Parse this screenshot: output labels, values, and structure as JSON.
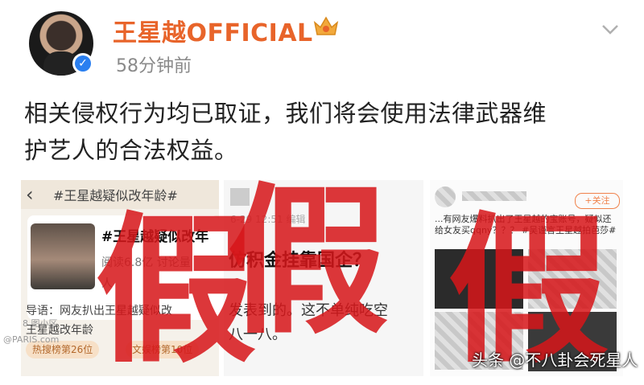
{
  "post": {
    "username": "王星越OFFICIAL",
    "time": "58分钟前",
    "text_line1": "相关侵权行为均已取证，我们将会使用法律武器维",
    "text_line2": "护艺人的合法权益。"
  },
  "image1": {
    "tag": "#王星越疑似改年龄#",
    "card_title": "#王星越疑似改年",
    "stat_line": "阅读6.8亿 讨论量",
    "stat_line2": "人",
    "guide": "导语：网友扒出王星越疑似改",
    "guide2": "王星越改年龄",
    "pill1": "热搜榜第26位",
    "pill2": "文娱榜第10位",
    "watermark": "8 图小区",
    "site_watermark": "@PARIS.com"
  },
  "image2": {
    "meta": "6-29 12:51 编辑",
    "headline": "仿积金挂靠国企？",
    "body1": "发表到的。这不单纯吃空",
    "body2": "八一八。"
  },
  "image3": {
    "follow": "+关注",
    "text": "...有网友爆料扒出了王星越的宝账号，疑似还给女友买qqny？？？ #吴谨言王星越拍芭莎#"
  },
  "overlay": {
    "fake_1": "假",
    "fake_2": "假",
    "fake_3": "假",
    "source": "头条 @不八卦会死星人"
  },
  "colors": {
    "username": "#e8642a",
    "stamp": "#d6161a"
  }
}
